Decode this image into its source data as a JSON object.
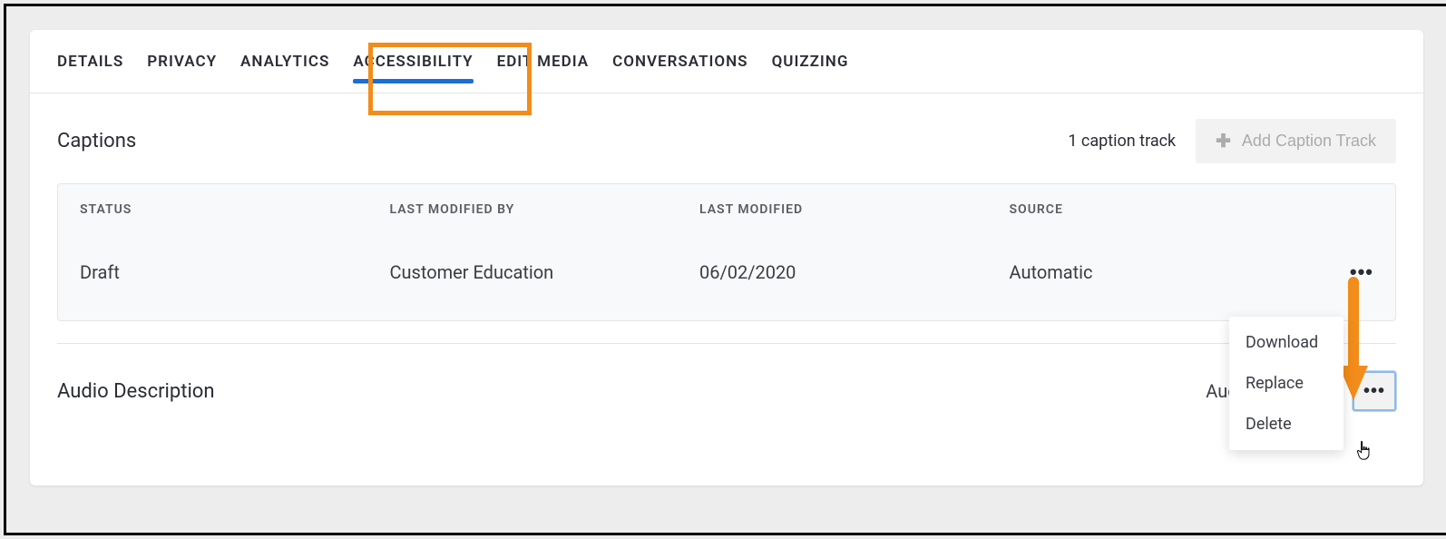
{
  "tabs": [
    {
      "label": "DETAILS"
    },
    {
      "label": "PRIVACY"
    },
    {
      "label": "ANALYTICS"
    },
    {
      "label": "ACCESSIBILITY"
    },
    {
      "label": "EDIT MEDIA"
    },
    {
      "label": "CONVERSATIONS"
    },
    {
      "label": "QUIZZING"
    }
  ],
  "captions": {
    "title": "Captions",
    "count_text": "1 caption track",
    "add_button": "Add Caption Track",
    "headers": {
      "status": "STATUS",
      "modified_by": "LAST MODIFIED BY",
      "modified": "LAST MODIFIED",
      "source": "SOURCE"
    },
    "rows": [
      {
        "status": "Draft",
        "modified_by": "Customer Education",
        "modified": "06/02/2020",
        "source": "Automatic"
      }
    ]
  },
  "audio": {
    "title": "Audio Description",
    "label": "AudioDescriptio",
    "menu": {
      "download": "Download",
      "replace": "Replace",
      "delete": "Delete"
    }
  }
}
